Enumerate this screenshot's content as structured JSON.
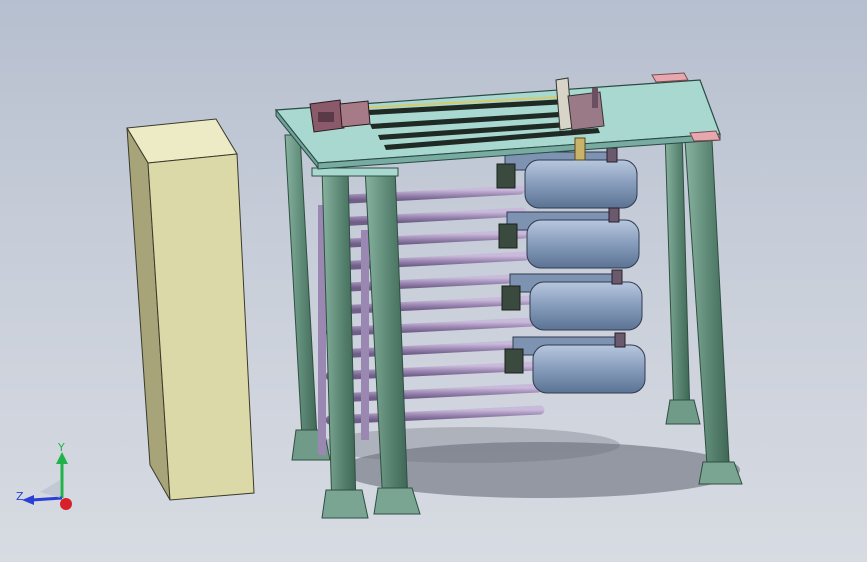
{
  "viewport": {
    "background": "#c3c9d5"
  },
  "triad": {
    "y_label": "Y",
    "z_label": "Z",
    "x_color": "#d8202a",
    "y_color": "#22b24c",
    "z_color": "#2a3fd6"
  },
  "colors": {
    "cabinet_front": "#dcd9a8",
    "cabinet_side": "#a7a47a",
    "cabinet_top": "#ecebc6",
    "frame": "#5f8a78",
    "frame_dark": "#3f6a59",
    "platform_top": "#a8d8cf",
    "pipe": "#a391b6",
    "pipe_dark": "#7b6a92",
    "tank": "#8aa1bf",
    "tank_dark": "#5f7898",
    "rail": "#1f2a25",
    "pad_pink": "#e7a7ae"
  }
}
